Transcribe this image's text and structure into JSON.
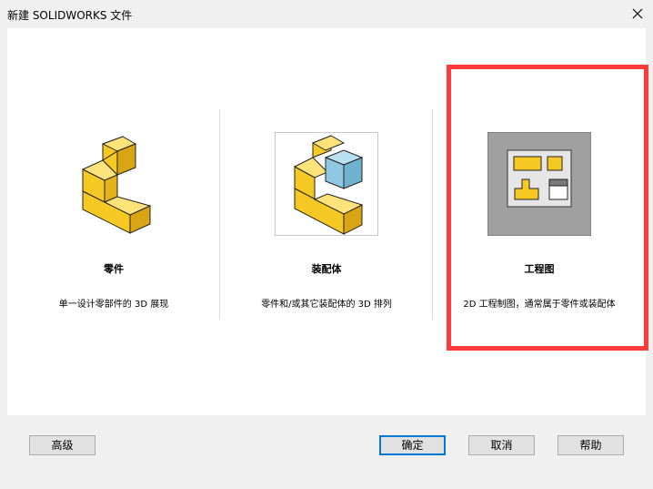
{
  "window": {
    "title": "新建 SOLIDWORKS 文件",
    "close_glyph": "✕"
  },
  "templates": [
    {
      "label": "零件",
      "description": "单一设计零部件的 3D 展现",
      "icon": "part-icon"
    },
    {
      "label": "装配体",
      "description": "零件和/或其它装配体的 3D 排列",
      "icon": "assembly-icon"
    },
    {
      "label": "工程图",
      "description": "2D 工程制图，通常属于零件或装配体",
      "icon": "drawing-icon"
    }
  ],
  "buttons": {
    "advanced": "高级",
    "ok": "确定",
    "cancel": "取消",
    "help": "帮助"
  },
  "colors": {
    "highlight": "#ff3a3a",
    "part_yellow": "#f5c823",
    "assembly_blue": "#8fc8e0"
  }
}
